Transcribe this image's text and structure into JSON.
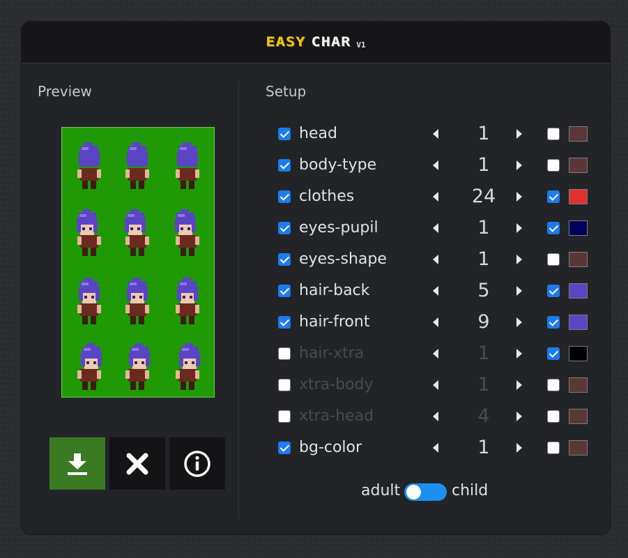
{
  "app": {
    "logo_easy": "EASY",
    "logo_char": "CHAR",
    "logo_version": "V1"
  },
  "preview": {
    "title": "Preview",
    "background_color": "#1f9a05",
    "sprite_hair_color": "#5b45c4"
  },
  "actions": {
    "download_icon": "download-icon",
    "clear_icon": "close-icon",
    "info_icon": "info-icon"
  },
  "setup": {
    "title": "Setup",
    "rows": [
      {
        "label": "head",
        "enabled": true,
        "value": "1",
        "color_enabled": false,
        "color": "#5a3838"
      },
      {
        "label": "body-type",
        "enabled": true,
        "value": "1",
        "color_enabled": false,
        "color": "#5a3838"
      },
      {
        "label": "clothes",
        "enabled": true,
        "value": "24",
        "color_enabled": true,
        "color": "#e0302f"
      },
      {
        "label": "eyes-pupil",
        "enabled": true,
        "value": "1",
        "color_enabled": true,
        "color": "#00005a"
      },
      {
        "label": "eyes-shape",
        "enabled": true,
        "value": "1",
        "color_enabled": false,
        "color": "#5a3838"
      },
      {
        "label": "hair-back",
        "enabled": true,
        "value": "5",
        "color_enabled": true,
        "color": "#5b45c4"
      },
      {
        "label": "hair-front",
        "enabled": true,
        "value": "9",
        "color_enabled": true,
        "color": "#5b45c4"
      },
      {
        "label": "hair-xtra",
        "enabled": false,
        "value": "1",
        "color_enabled": true,
        "color": "#000000"
      },
      {
        "label": "xtra-body",
        "enabled": false,
        "value": "1",
        "color_enabled": false,
        "color": "#5a3838"
      },
      {
        "label": "xtra-head",
        "enabled": false,
        "value": "4",
        "color_enabled": false,
        "color": "#5a3838"
      },
      {
        "label": "bg-color",
        "enabled": true,
        "value": "1",
        "color_enabled": false,
        "color": "#5a3838"
      }
    ]
  },
  "age_toggle": {
    "left_label": "adult",
    "right_label": "child",
    "selected": "adult"
  }
}
